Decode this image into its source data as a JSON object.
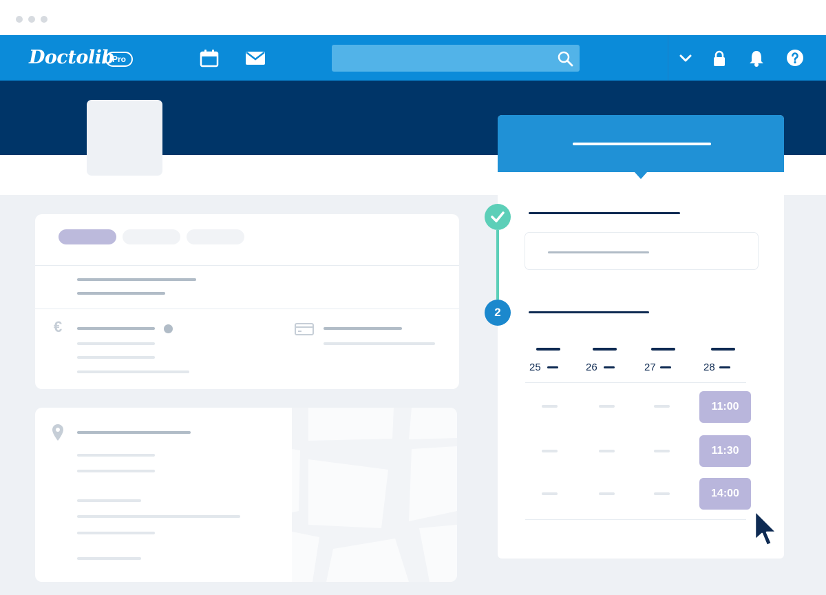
{
  "navbar": {
    "brand": "Doctolib",
    "badge": "Pro",
    "icons": [
      "calendar-icon",
      "mail-icon",
      "search-icon",
      "chevron-down-icon",
      "lock-icon",
      "bell-icon",
      "help-icon"
    ]
  },
  "booking": {
    "step_number": "2",
    "days": [
      {
        "number": "25"
      },
      {
        "number": "26"
      },
      {
        "number": "27"
      },
      {
        "number": "28"
      }
    ],
    "slots": [
      "11:00",
      "11:30",
      "14:00"
    ]
  },
  "colors": {
    "primary": "#0b8bd9",
    "header_band": "#003568",
    "panel_header": "#2091d6",
    "success": "#5ccfb8",
    "slot": "#b9b6dc"
  }
}
